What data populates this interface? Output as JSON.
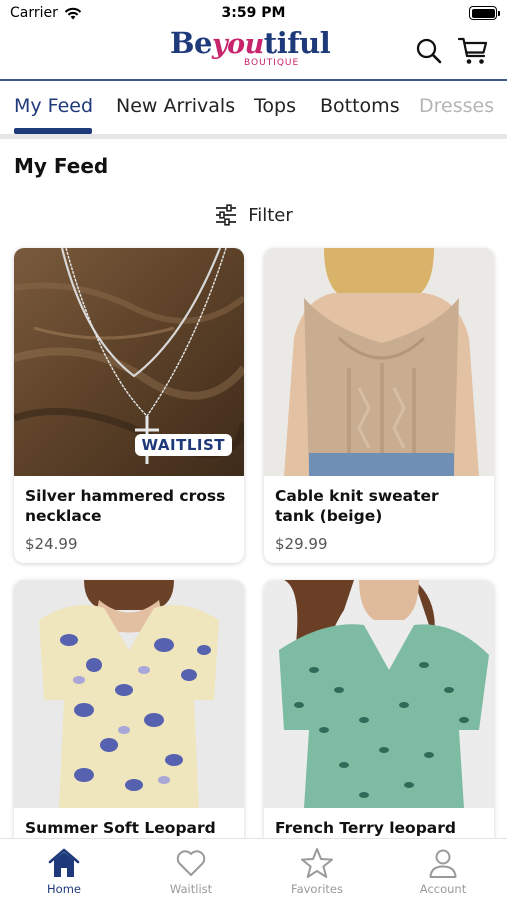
{
  "status_bar": {
    "carrier": "Carrier",
    "time": "3:59 PM"
  },
  "header": {
    "logo_part1": "Be",
    "logo_part2": "you",
    "logo_part3": "tiful",
    "logo_sub": "BOUTIQUE"
  },
  "tabs": [
    {
      "label": "My Feed",
      "active": true
    },
    {
      "label": "New Arrivals"
    },
    {
      "label": "Tops"
    },
    {
      "label": "Bottoms"
    },
    {
      "label": "Dresses"
    }
  ],
  "feed": {
    "title": "My Feed",
    "filter_label": "Filter"
  },
  "products": [
    {
      "name": "Silver hammered cross necklace",
      "price": "$24.99",
      "badge": "WAITLIST"
    },
    {
      "name": "Cable knit sweater tank (beige)",
      "price": "$29.99"
    },
    {
      "name": "Summer Soft Leopard top"
    },
    {
      "name": "French Terry leopard"
    }
  ],
  "bottom_nav": [
    {
      "label": "Home",
      "icon": "home-icon",
      "active": true
    },
    {
      "label": "Waitlist",
      "icon": "heart-icon"
    },
    {
      "label": "Favorites",
      "icon": "star-icon"
    },
    {
      "label": "Account",
      "icon": "account-icon"
    }
  ],
  "colors": {
    "brand_navy": "#1f3a7a",
    "brand_pink": "#c8246e"
  }
}
